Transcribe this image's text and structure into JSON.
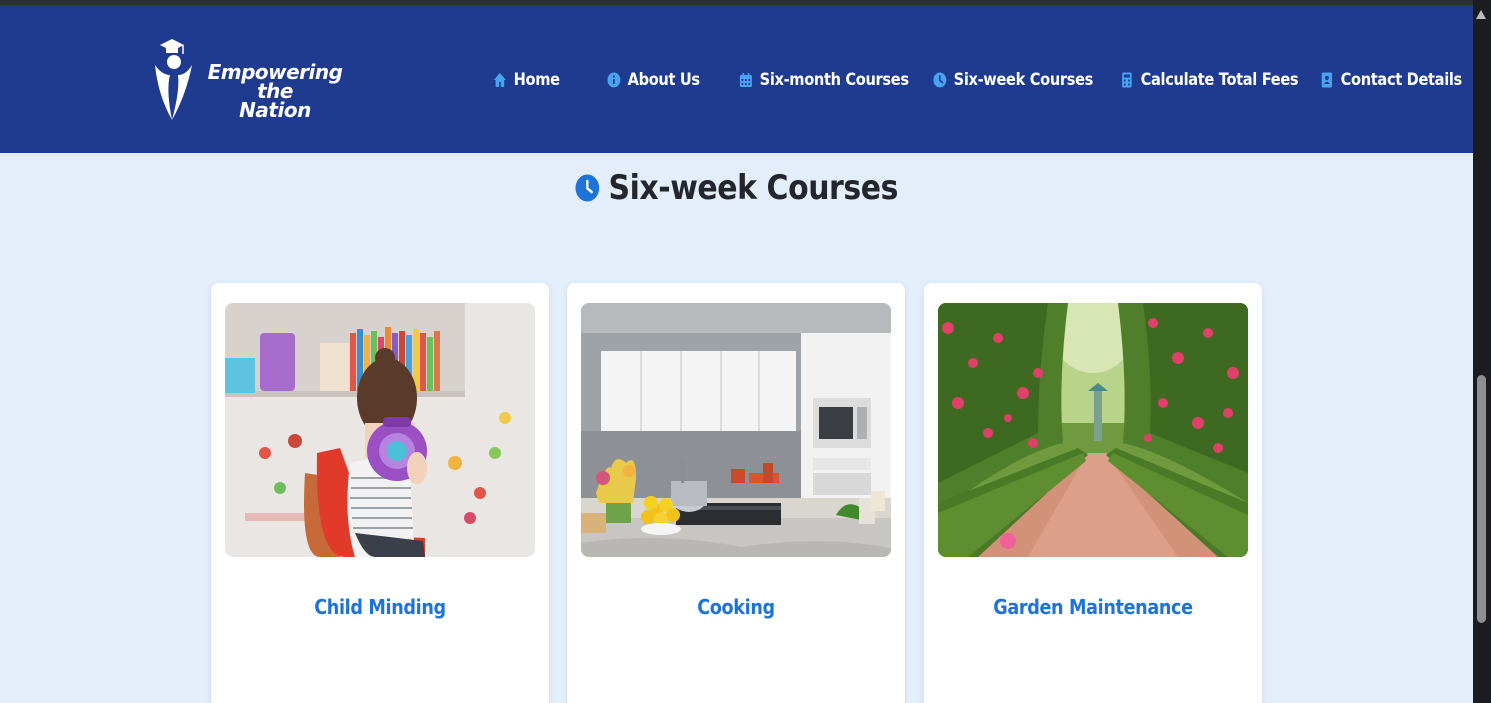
{
  "brand": {
    "line1": "Empowering the",
    "line2": "Nation"
  },
  "nav": [
    {
      "label": "Home",
      "icon": "home-icon"
    },
    {
      "label": "About Us",
      "icon": "info-icon"
    },
    {
      "label": "Six-month Courses",
      "icon": "calendar-icon"
    },
    {
      "label": "Six-week Courses",
      "icon": "clock-icon"
    },
    {
      "label": "Calculate Total Fees",
      "icon": "calculator-icon"
    },
    {
      "label": "Contact Details",
      "icon": "contact-book-icon"
    }
  ],
  "page": {
    "title": "Six-week Courses",
    "title_icon": "clock-icon"
  },
  "courses": [
    {
      "title": "Child Minding",
      "image": "child-minding-photo"
    },
    {
      "title": "Cooking",
      "image": "cooking-kitchen-photo"
    },
    {
      "title": "Garden Maintenance",
      "image": "garden-path-photo"
    }
  ],
  "colors": {
    "header": "#1f3b8f",
    "background": "#e3eefa",
    "accent": "#1e73d8",
    "nav_icon": "#4aa3f0"
  }
}
